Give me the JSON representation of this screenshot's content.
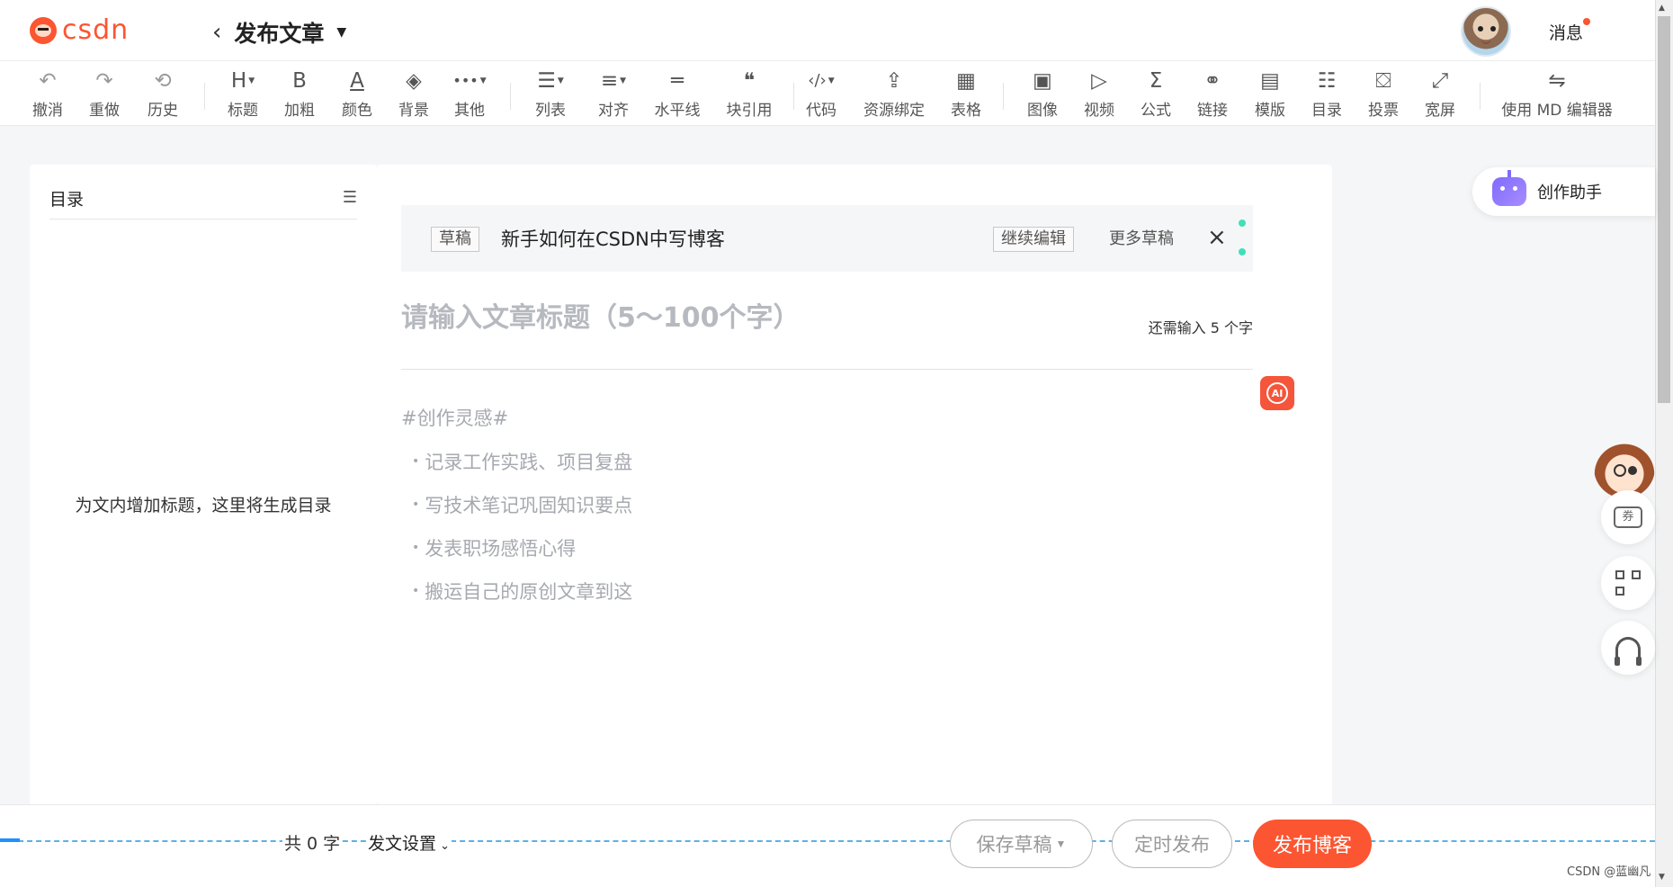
{
  "header": {
    "logo_text": "csdn",
    "page_title": "发布文章",
    "messages_label": "消息"
  },
  "toolbar": {
    "items": [
      {
        "label": "撤消",
        "icon": "↶"
      },
      {
        "label": "重做",
        "icon": "↷"
      },
      {
        "label": "历史",
        "icon": "⟲"
      },
      {
        "label": "标题",
        "icon": "H"
      },
      {
        "label": "加粗",
        "icon": "B"
      },
      {
        "label": "颜色",
        "icon": "A"
      },
      {
        "label": "背景",
        "icon": "◈"
      },
      {
        "label": "其他",
        "icon": "•••"
      },
      {
        "label": "列表",
        "icon": "☰"
      },
      {
        "label": "对齐",
        "icon": "≡"
      },
      {
        "label": "水平线",
        "icon": "═"
      },
      {
        "label": "块引用",
        "icon": "❝"
      },
      {
        "label": "代码",
        "icon": "‹/›"
      },
      {
        "label": "资源绑定",
        "icon": "⇪"
      },
      {
        "label": "表格",
        "icon": "▦"
      },
      {
        "label": "图像",
        "icon": "▣"
      },
      {
        "label": "视频",
        "icon": "▷"
      },
      {
        "label": "公式",
        "icon": "Σ"
      },
      {
        "label": "链接",
        "icon": "⚭"
      },
      {
        "label": "模版",
        "icon": "▤"
      },
      {
        "label": "目录",
        "icon": "☷"
      },
      {
        "label": "投票",
        "icon": "⛋"
      },
      {
        "label": "宽屏",
        "icon": "⤢"
      },
      {
        "label": "使用 MD 编辑器",
        "icon": "⇋"
      }
    ]
  },
  "toc": {
    "title": "目录",
    "empty_text": "为文内增加标题，这里将生成目录"
  },
  "draft_bar": {
    "tag": "草稿",
    "name": "新手如何在CSDN中写博客",
    "continue_label": "继续编辑",
    "more_label": "更多草稿"
  },
  "editor": {
    "title_placeholder": "请输入文章标题（5～100个字）",
    "remaining_text": "还需输入 5 个字",
    "ai_label": "AI",
    "placeholder_head": "#创作灵感#",
    "placeholder_items": [
      "记录工作实践、项目复盘",
      "写技术笔记巩固知识要点",
      "发表职场感悟心得",
      "搬运自己的原创文章到这"
    ]
  },
  "assistant": {
    "label": "创作助手"
  },
  "float": {
    "coupon_label": "券"
  },
  "bottom": {
    "word_count": "共 0 字",
    "settings_label": "发文设置",
    "save_draft_label": "保存草稿",
    "schedule_label": "定时发布",
    "publish_label": "发布博客",
    "watermark": "CSDN @蓝幽凡"
  },
  "colors": {
    "brand": "#fc5531",
    "ai": "#f5553a",
    "assistant": "#7f6bff",
    "dash": "#5bb1e6"
  }
}
